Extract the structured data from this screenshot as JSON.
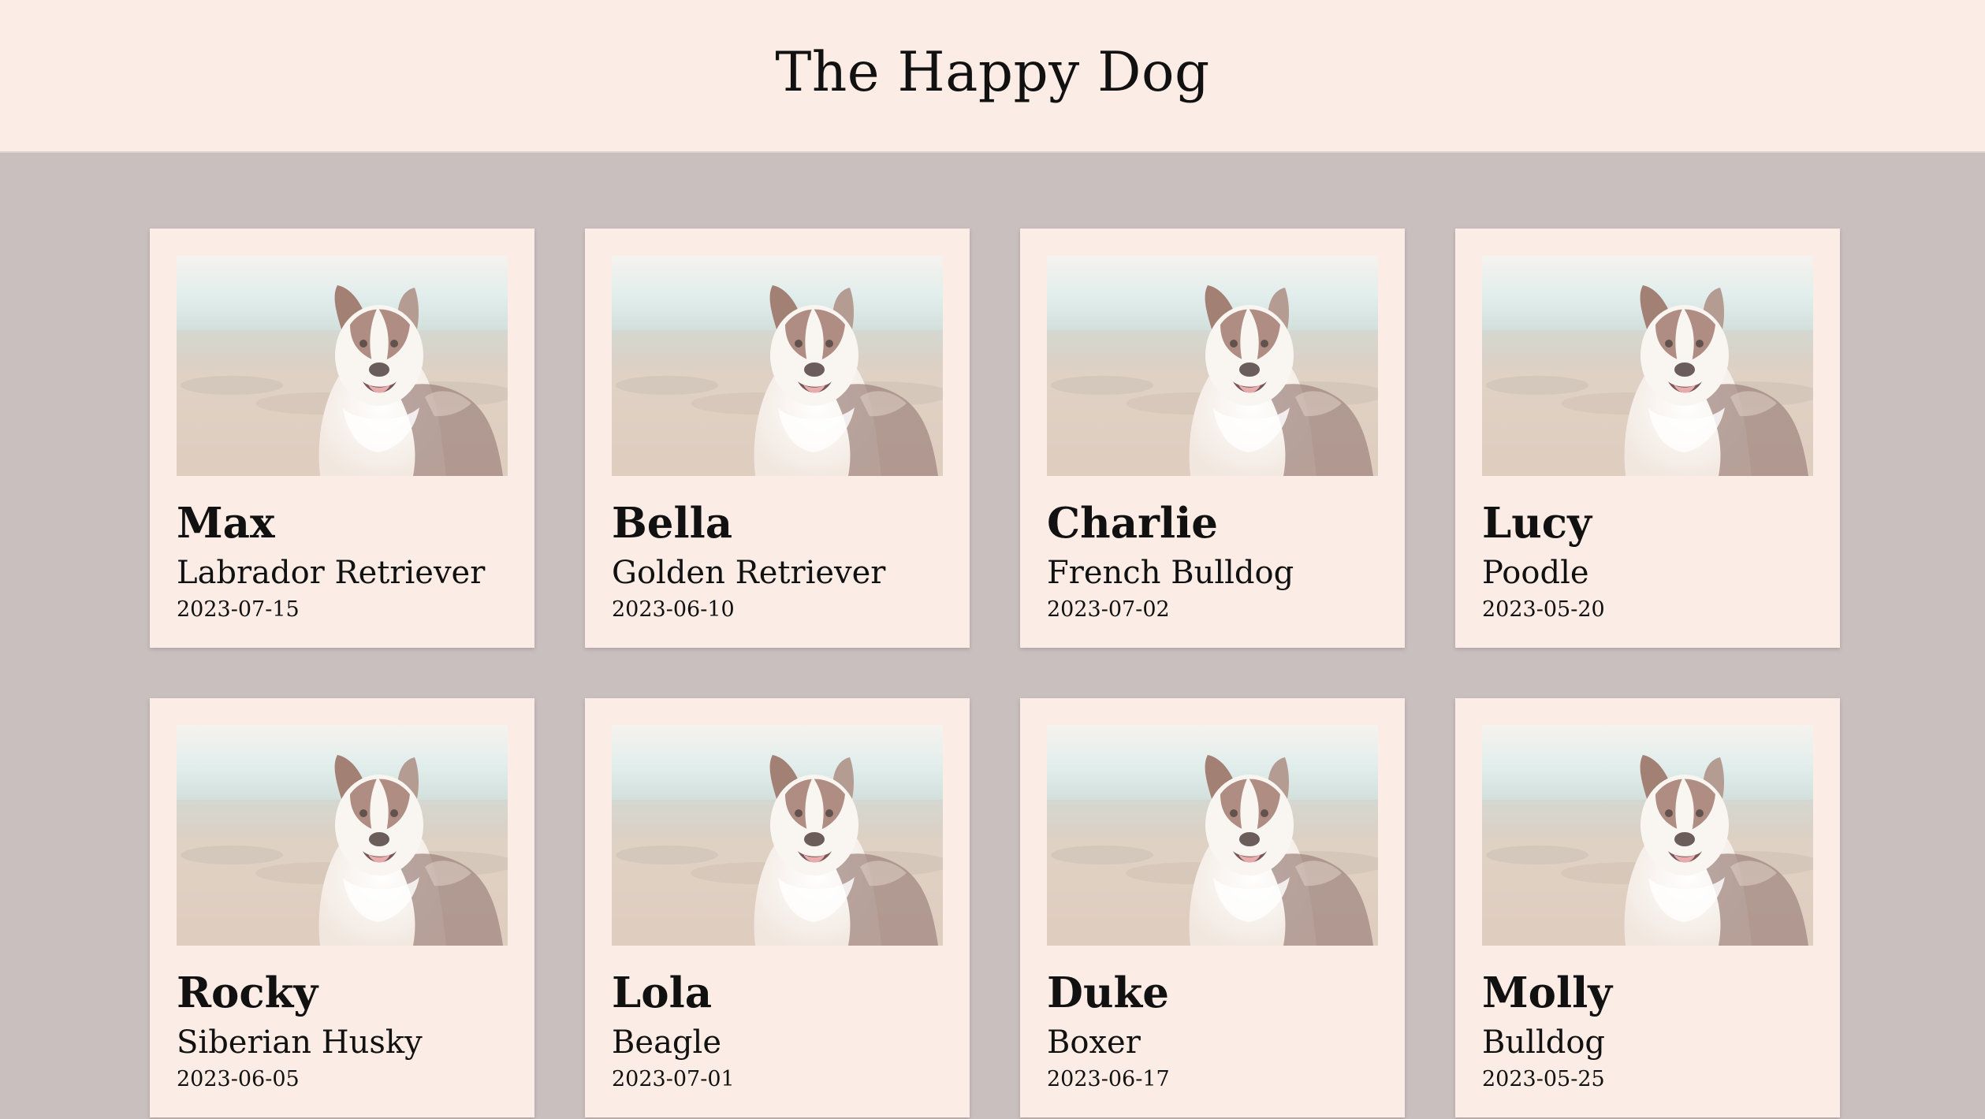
{
  "header": {
    "title": "The Happy Dog"
  },
  "dogs": [
    {
      "name": "Max",
      "breed": "Labrador Retriever",
      "date": "2023-07-15"
    },
    {
      "name": "Bella",
      "breed": "Golden Retriever",
      "date": "2023-06-10"
    },
    {
      "name": "Charlie",
      "breed": "French Bulldog",
      "date": "2023-07-02"
    },
    {
      "name": "Lucy",
      "breed": "Poodle",
      "date": "2023-05-20"
    },
    {
      "name": "Rocky",
      "breed": "Siberian Husky",
      "date": "2023-06-05"
    },
    {
      "name": "Lola",
      "breed": "Beagle",
      "date": "2023-07-01"
    },
    {
      "name": "Duke",
      "breed": "Boxer",
      "date": "2023-06-17"
    },
    {
      "name": "Molly",
      "breed": "Bulldog",
      "date": "2023-05-25"
    }
  ],
  "colors": {
    "page_background": "#c9bfbe",
    "header_background": "#fbede5",
    "card_background": "#fbede5"
  },
  "icons": {
    "photo": "dog-photo"
  }
}
